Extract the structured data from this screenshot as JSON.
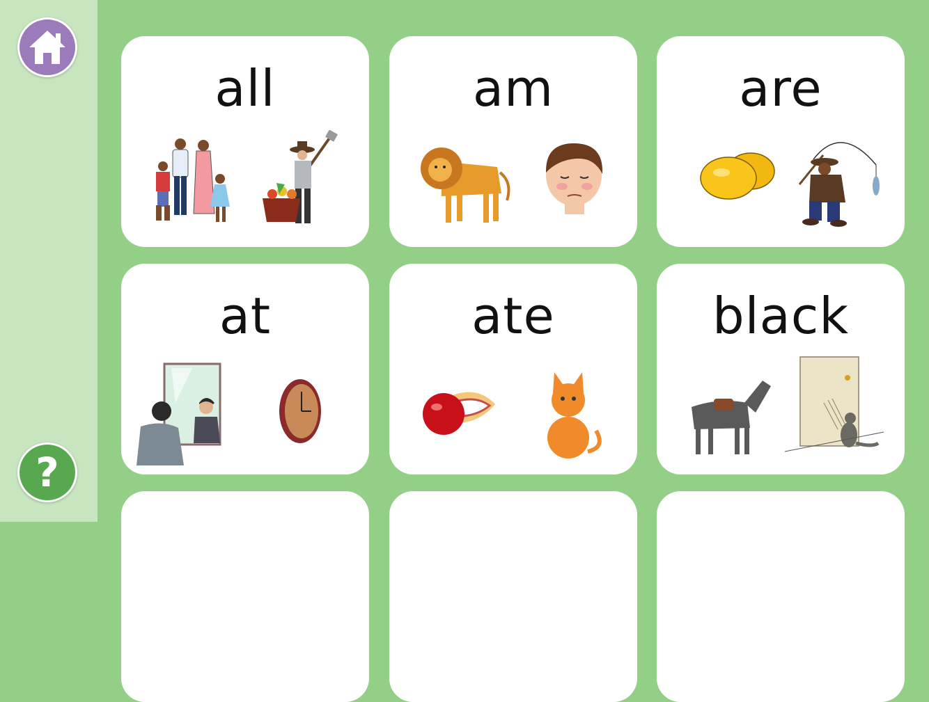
{
  "sidebar": {
    "home": {
      "icon": "home-icon",
      "color": "#9b7bb9"
    },
    "help": {
      "icon": "help-icon",
      "label": "?",
      "color": "#57a84f"
    }
  },
  "colors": {
    "background": "#93cf86",
    "sidebar": "#c7e6bf",
    "card": "#ffffff"
  },
  "cards": [
    {
      "word": "all",
      "pictures": [
        "family-picture",
        "farmer-picture"
      ]
    },
    {
      "word": "am",
      "pictures": [
        "lion-picture",
        "sad-boy-picture"
      ]
    },
    {
      "word": "are",
      "pictures": [
        "lemons-picture",
        "fisherman-picture"
      ]
    },
    {
      "word": "at",
      "pictures": [
        "man-at-mirror-picture",
        "clock-picture"
      ]
    },
    {
      "word": "ate",
      "pictures": [
        "mouth-eating-apple-picture",
        "cat-picture"
      ]
    },
    {
      "word": "black",
      "pictures": [
        "horse-picture",
        "cat-scratching-door-picture"
      ]
    }
  ]
}
